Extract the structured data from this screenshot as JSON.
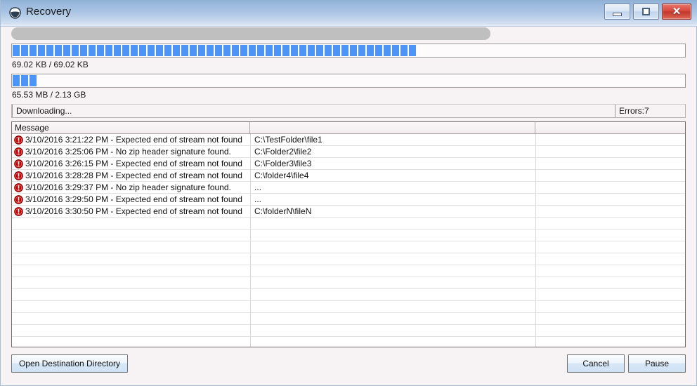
{
  "window": {
    "title": "Recovery",
    "icon": "recovery-shield-icon",
    "controls": {
      "minimize_label": "Minimize",
      "maximize_label": "Maximize",
      "close_label": "Close"
    }
  },
  "progress": {
    "marquee": {
      "fill_percent": 71
    },
    "file": {
      "segments": 48,
      "label": "69.02 KB / 69.02 KB",
      "current": "69.02 KB",
      "total": "69.02 KB"
    },
    "total": {
      "segments": 3,
      "label": "65.53 MB / 2.13 GB",
      "current": "65.53 MB",
      "total": "2.13 GB"
    }
  },
  "status": {
    "message": "Downloading...",
    "errors": "Errors:7"
  },
  "list": {
    "columns": [
      "Message",
      "",
      ""
    ],
    "rows": [
      {
        "icon": "error-icon",
        "message": "3/10/2016 3:21:22 PM - Expected end of stream not found",
        "path": "C:\\TestFolder\\file1"
      },
      {
        "icon": "error-icon",
        "message": "3/10/2016 3:25:06 PM - No zip header signature found.",
        "path": "C:\\Folder2\\file2"
      },
      {
        "icon": "error-icon",
        "message": "3/10/2016 3:26:15 PM - Expected end of stream not found",
        "path": "C:\\Folder3\\file3"
      },
      {
        "icon": "error-icon",
        "message": "3/10/2016 3:28:28 PM - Expected end of stream not found",
        "path": "C:\\folder4\\file4"
      },
      {
        "icon": "error-icon",
        "message": "3/10/2016 3:29:37 PM - No zip header signature found.",
        "path": "..."
      },
      {
        "icon": "error-icon",
        "message": "3/10/2016 3:29:50 PM - Expected end of stream not found",
        "path": "..."
      },
      {
        "icon": "error-icon",
        "message": "3/10/2016 3:30:50 PM - Expected end of stream not found",
        "path": "C:\\folderN\\fileN"
      }
    ],
    "empty_rows": 11
  },
  "buttons": {
    "open_destination": "Open Destination Directory",
    "cancel": "Cancel",
    "pause": "Pause"
  },
  "colors": {
    "progress_blue": "#4d94f7",
    "marquee_gray": "#bfbfbf",
    "error_red": "#c00000",
    "titlebar_blue": "#a7c2e2",
    "client_bg": "#f7f2f4"
  }
}
